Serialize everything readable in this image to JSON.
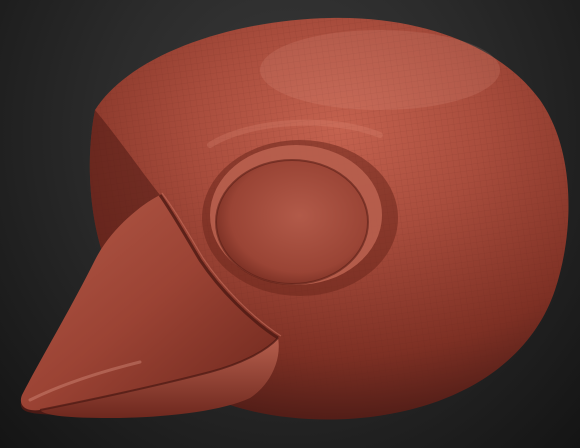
{
  "scene": {
    "kind": "3d-sculpt-viewport",
    "subject": "bird skull",
    "material_color": "#a2473a",
    "highlight_color": "#d07a6a",
    "shadow_color": "#4a1a15",
    "background_top": "#3a3a3a",
    "background_bottom": "#141414",
    "wireframe_visible": true
  }
}
